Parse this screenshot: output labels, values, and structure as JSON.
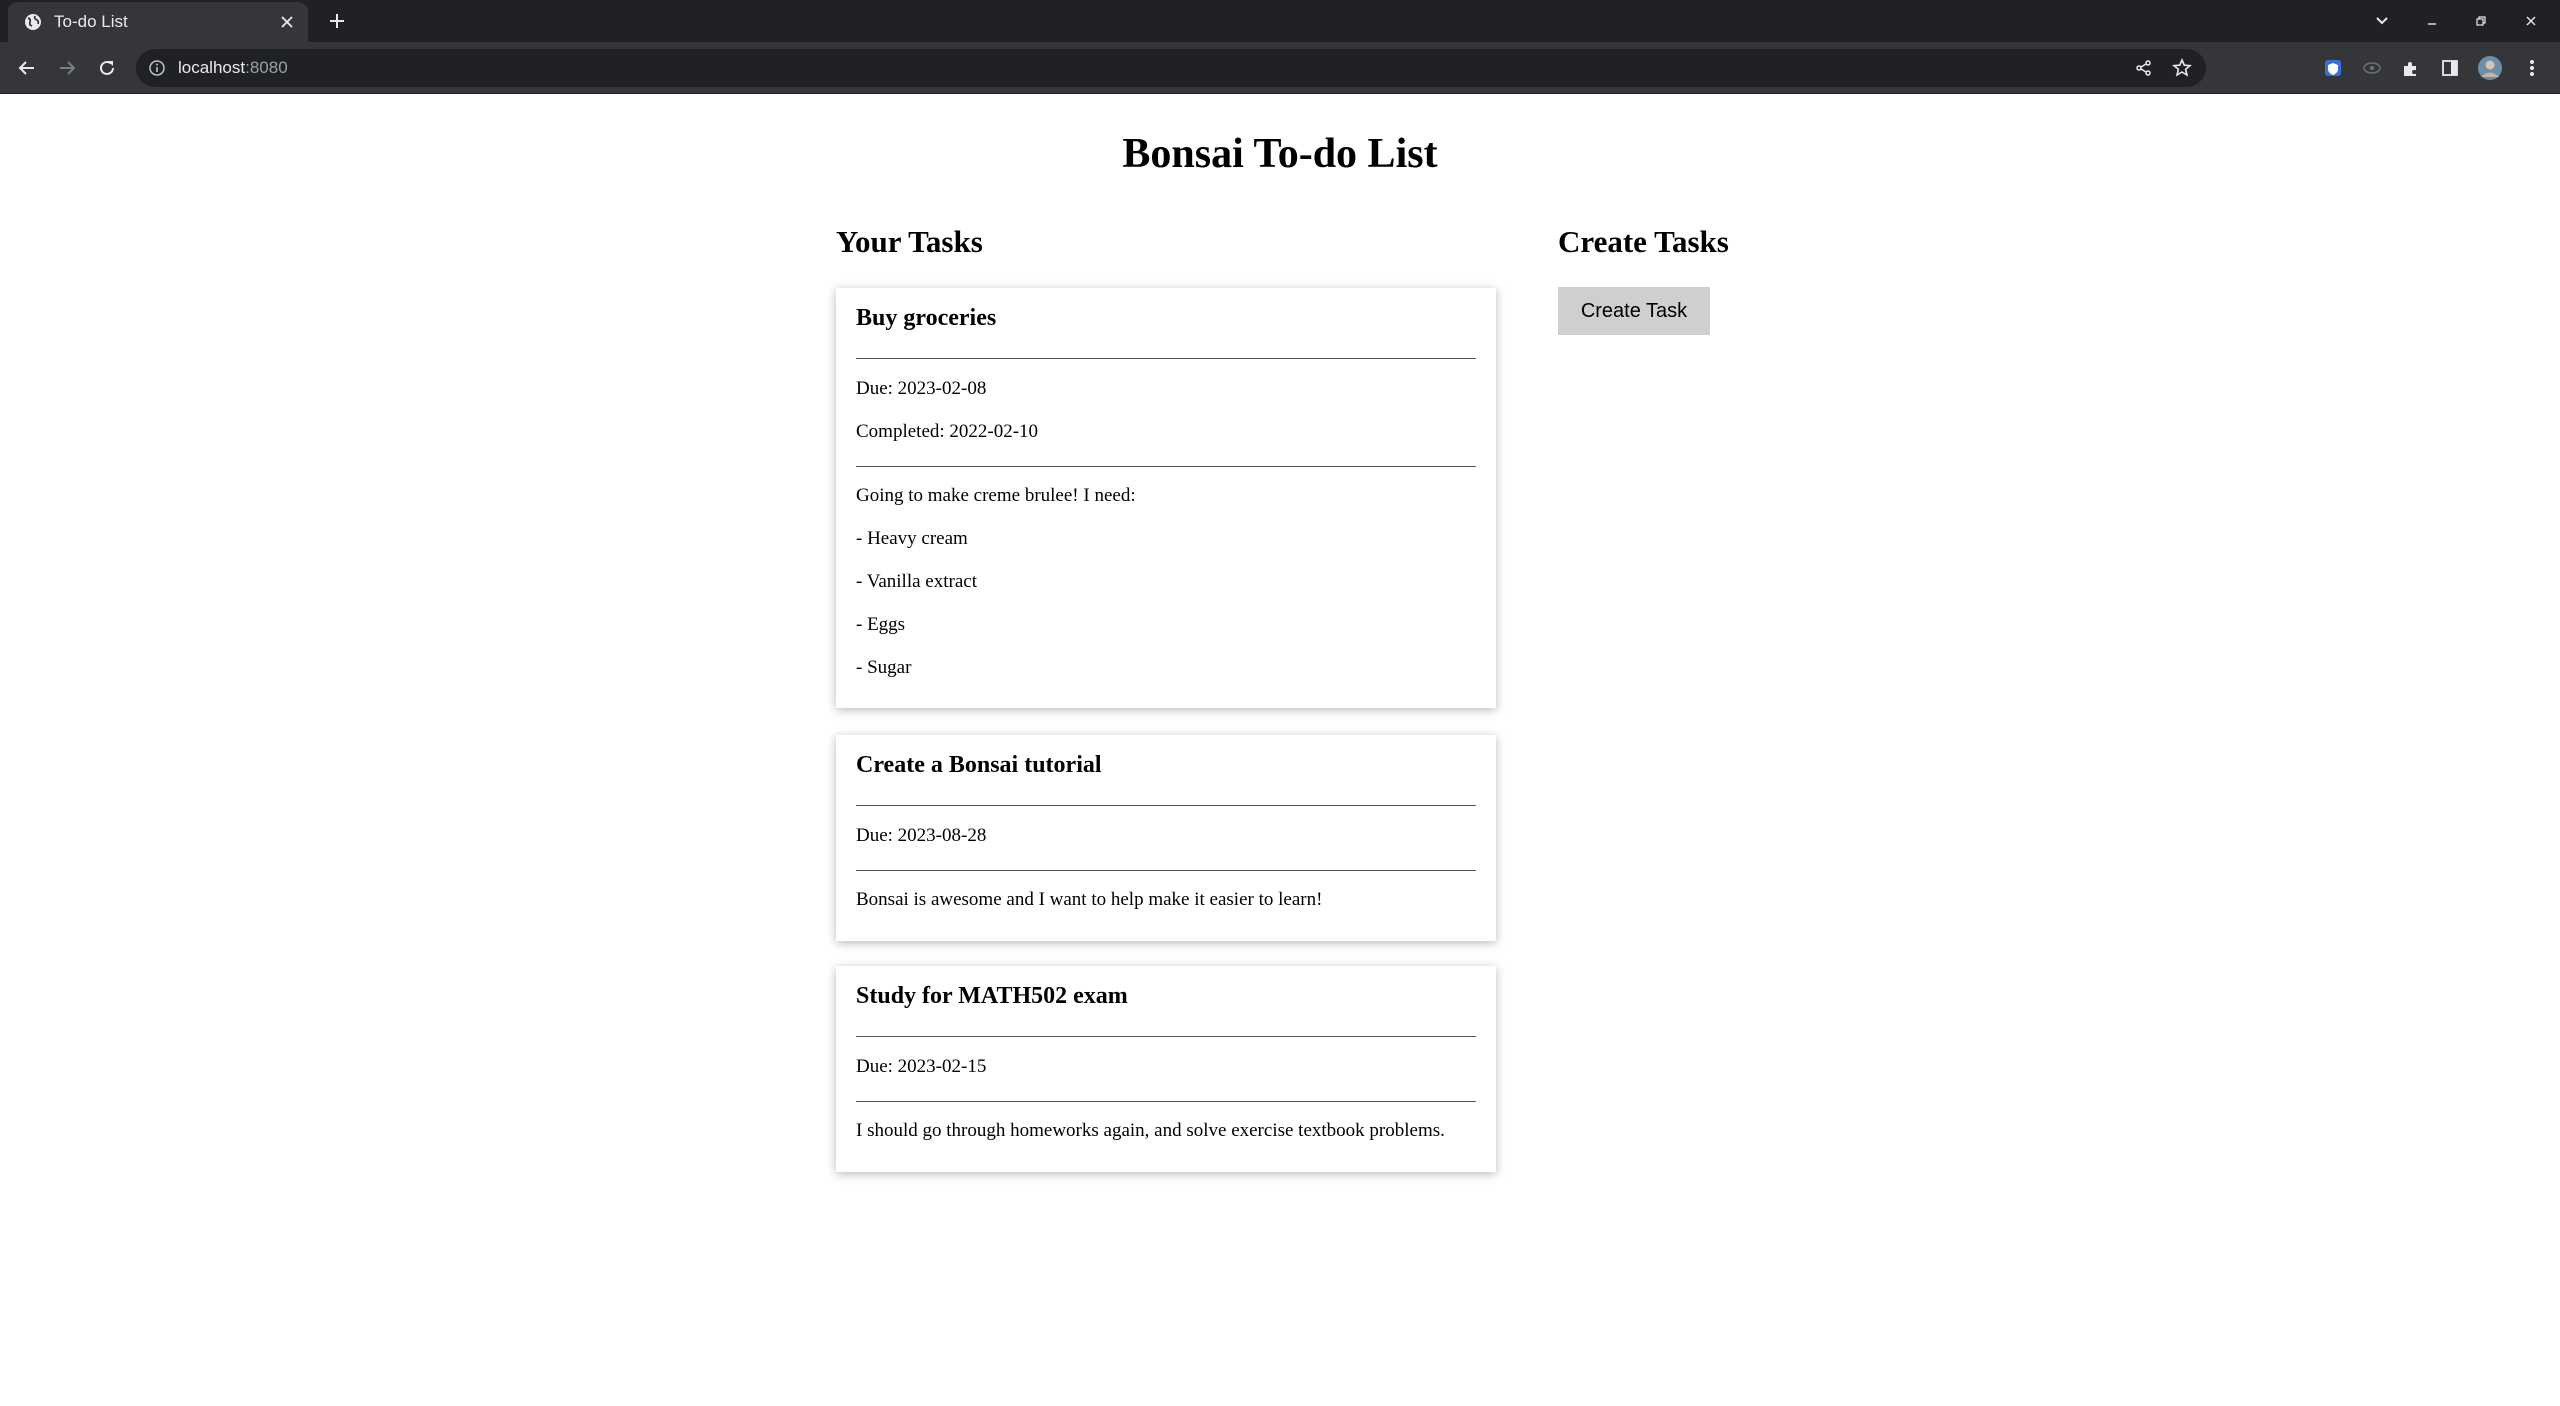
{
  "browser": {
    "tab_title": "To-do List",
    "url_host": "localhost",
    "url_port": ":8080"
  },
  "page": {
    "title": "Bonsai To-do List",
    "tasks_heading": "Your Tasks",
    "create_heading": "Create Tasks",
    "create_button_label": "Create Task"
  },
  "tasks": [
    {
      "title": "Buy groceries",
      "due": "Due: 2023-02-08",
      "completed": "Completed: 2022-02-10",
      "description": [
        "Going to make creme brulee! I need:",
        "- Heavy cream",
        "- Vanilla extract",
        "- Eggs",
        "- Sugar"
      ]
    },
    {
      "title": "Create a Bonsai tutorial",
      "due": "Due: 2023-08-28",
      "description": [
        "Bonsai is awesome and I want to help make it easier to learn!"
      ]
    },
    {
      "title": "Study for MATH502 exam",
      "due": "Due: 2023-02-15",
      "description": [
        "I should go through homeworks again, and solve exercise textbook problems."
      ]
    }
  ],
  "icons": {
    "tab_favicon": "globe-icon",
    "tab_close": "close-icon",
    "new_tab": "plus-icon",
    "back": "arrow-left-icon",
    "forward": "arrow-right-icon",
    "reload": "reload-icon",
    "site_info": "info-icon",
    "share": "share-icon",
    "bookmark": "star-icon"
  }
}
